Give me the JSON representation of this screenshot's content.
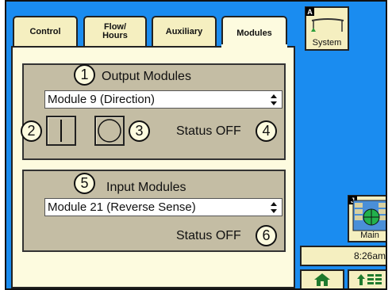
{
  "tabs": [
    {
      "label": "Control"
    },
    {
      "label_line1": "Flow/",
      "label_line2": "Hours"
    },
    {
      "label": "Auxiliary"
    },
    {
      "label": "Modules"
    }
  ],
  "output": {
    "num": "1",
    "title": "Output Modules",
    "selected": "Module 9 (Direction)",
    "btn_left_num": "2",
    "btn_right_num": "3",
    "status_label": "Status",
    "status_value": "OFF",
    "status_num": "4"
  },
  "input": {
    "num": "5",
    "title": "Input Modules",
    "selected": "Module 21 (Reverse Sense)",
    "status_label": "Status",
    "status_value": "OFF",
    "status_num": "6"
  },
  "side": {
    "system_letter": "A",
    "system_label": "System",
    "main_letter": "J",
    "main_label": "Main",
    "clock": "8:26am"
  },
  "colors": {
    "background": "#1a8cf0",
    "tab_face": "#f5efc0",
    "panel": "#fdfbdf",
    "group": "#c4bda4"
  }
}
